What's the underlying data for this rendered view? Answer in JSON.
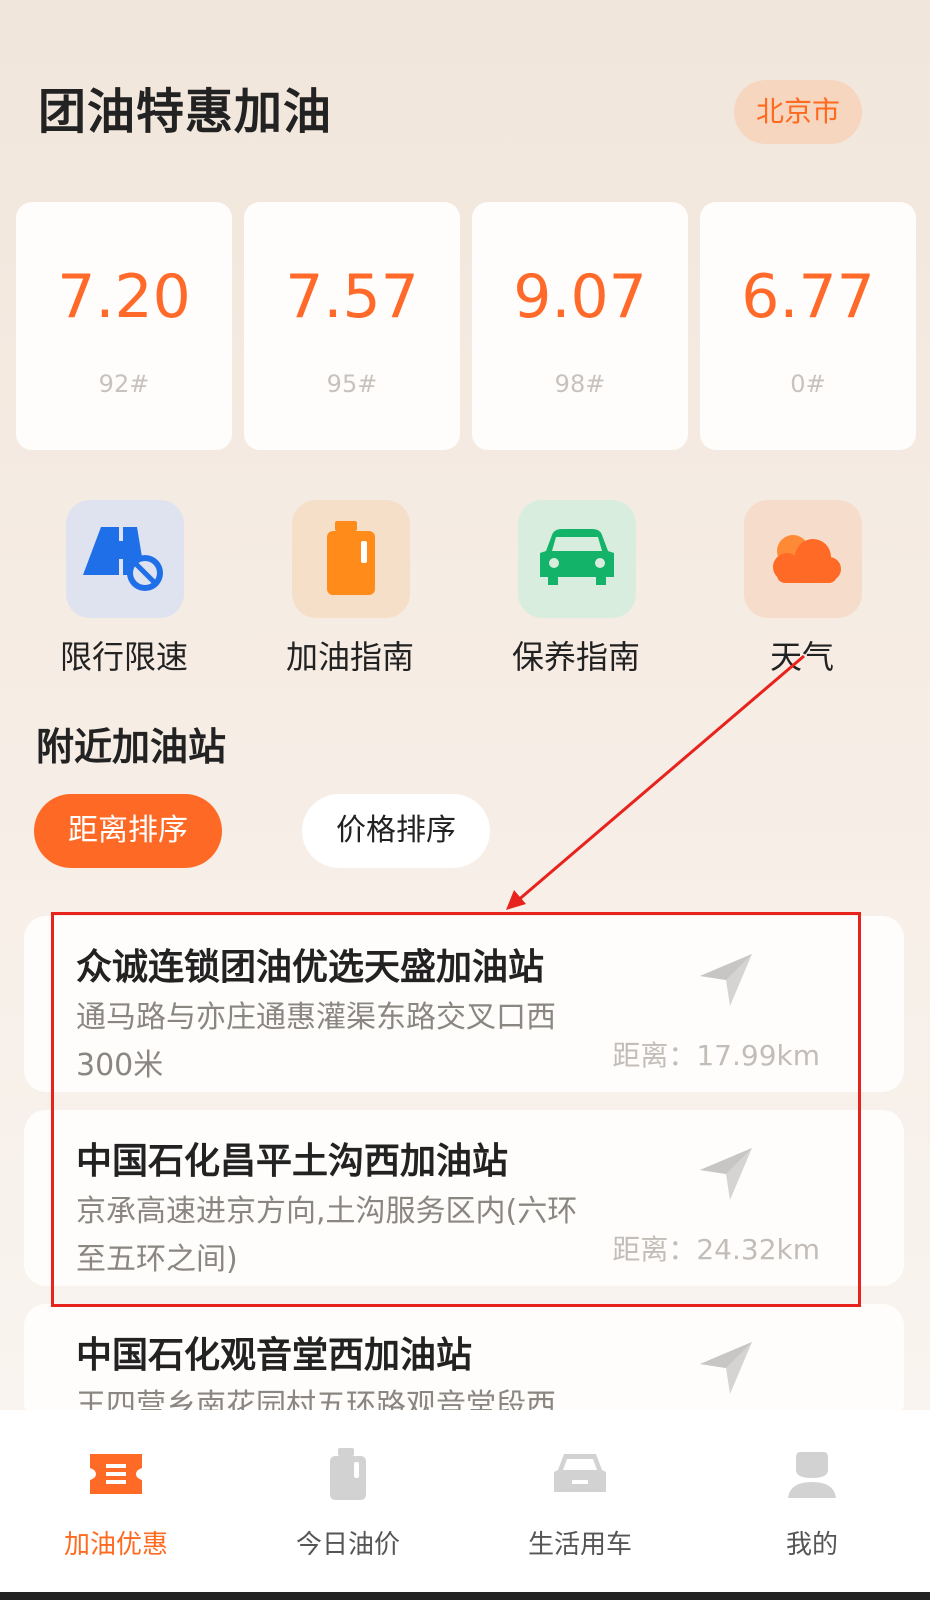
{
  "header": {
    "title": "团油特惠加油",
    "city": "北京市"
  },
  "prices": [
    {
      "value": "7.20",
      "type": "92#"
    },
    {
      "value": "7.57",
      "type": "95#"
    },
    {
      "value": "9.07",
      "type": "98#"
    },
    {
      "value": "6.77",
      "type": "0#"
    }
  ],
  "features": [
    {
      "label": "限行限速",
      "icon": "traffic-restriction-icon"
    },
    {
      "label": "加油指南",
      "icon": "fuel-can-icon"
    },
    {
      "label": "保养指南",
      "icon": "car-icon"
    },
    {
      "label": "天气",
      "icon": "cloud-icon"
    }
  ],
  "nearby": {
    "title": "附近加油站",
    "sort_distance": "距离排序",
    "sort_price": "价格排序",
    "stations": [
      {
        "name": "众诚连锁团油优选天盛加油站",
        "address": "通马路与亦庄通惠灌渠东路交叉口西300米",
        "distance": "距离：17.99km"
      },
      {
        "name": "中国石化昌平土沟西加油站",
        "address": "京承高速进京方向,土沟服务区内(六环至五环之间)",
        "distance": "距离：24.32km"
      },
      {
        "name": "中国石化观音堂西加油站",
        "address": "王四营乡南花园村五环路观音堂段西",
        "distance": ""
      }
    ]
  },
  "tabs": [
    {
      "label": "加油优惠",
      "icon": "coupon-icon",
      "active": true
    },
    {
      "label": "今日油价",
      "icon": "fuel-price-icon",
      "active": false
    },
    {
      "label": "生活用车",
      "icon": "car-life-icon",
      "active": false
    },
    {
      "label": "我的",
      "icon": "user-icon",
      "active": false
    }
  ],
  "colors": {
    "accent": "#ff6a26",
    "highlight": "#e8231d"
  }
}
